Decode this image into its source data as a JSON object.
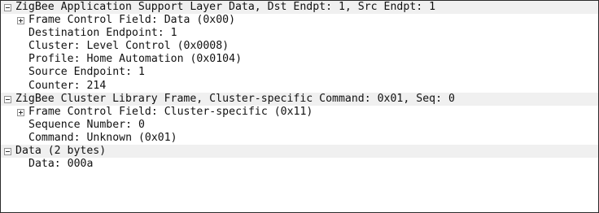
{
  "tree": {
    "zbee_aps": {
      "header": "ZigBee Application Support Layer Data, Dst Endpt: 1, Src Endpt: 1",
      "frame_control": "Frame Control Field: Data (0x00)",
      "destination_endpoint": "Destination Endpoint: 1",
      "cluster": "Cluster: Level Control (0x0008)",
      "profile": "Profile: Home Automation (0x0104)",
      "source_endpoint": "Source Endpoint: 1",
      "counter": "Counter: 214"
    },
    "zbee_zcl": {
      "header": "ZigBee Cluster Library Frame, Cluster-specific Command: 0x01, Seq: 0",
      "frame_control": "Frame Control Field: Cluster-specific (0x11)",
      "sequence_number": "Sequence Number: 0",
      "command": "Command: Unknown (0x01)"
    },
    "data": {
      "header": "Data (2 bytes)",
      "data": "Data: 000a"
    }
  }
}
